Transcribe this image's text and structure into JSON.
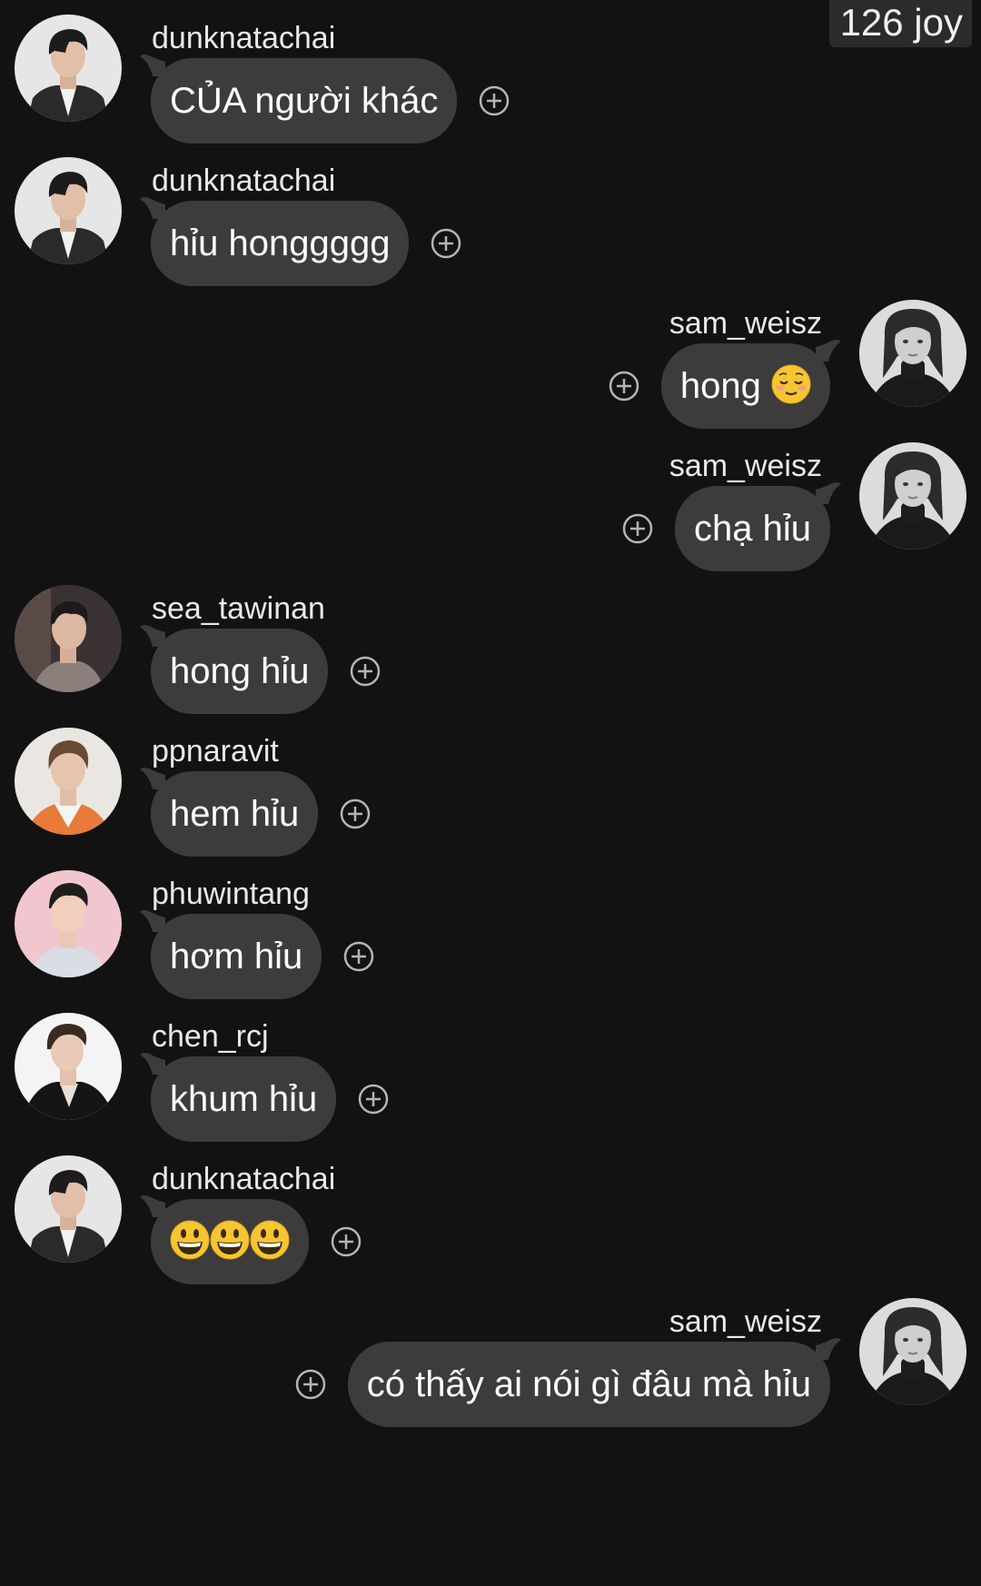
{
  "header": {
    "points_badge": "126 joy"
  },
  "colors": {
    "background": "#121212",
    "bubble": "#3c3c3c",
    "text": "#ffffff",
    "username": "#e9e9e9",
    "icon": "#b5b5b5"
  },
  "messages": [
    {
      "username": "dunknatachai",
      "text": "CỦA người khác",
      "side": "left",
      "avatar": "dunknatachai-avatar",
      "reaction_icon": "add-reaction-icon"
    },
    {
      "username": "dunknatachai",
      "text": "hỉu honggggg",
      "side": "left",
      "avatar": "dunknatachai-avatar",
      "reaction_icon": "add-reaction-icon"
    },
    {
      "username": "sam_weisz",
      "text": "hong",
      "emoji": "relieved-face-emoji",
      "side": "right",
      "avatar": "sam_weisz-avatar",
      "reaction_icon": "add-reaction-icon"
    },
    {
      "username": "sam_weisz",
      "text": "chạ hỉu",
      "side": "right",
      "avatar": "sam_weisz-avatar",
      "reaction_icon": "add-reaction-icon"
    },
    {
      "username": "sea_tawinan",
      "text": "hong hỉu",
      "side": "left",
      "avatar": "sea_tawinan-avatar",
      "reaction_icon": "add-reaction-icon"
    },
    {
      "username": "ppnaravit",
      "text": "hem hỉu",
      "side": "left",
      "avatar": "ppnaravit-avatar",
      "reaction_icon": "add-reaction-icon"
    },
    {
      "username": "phuwintang",
      "text": "hơm hỉu",
      "side": "left",
      "avatar": "phuwintang-avatar",
      "reaction_icon": "add-reaction-icon"
    },
    {
      "username": "chen_rcj",
      "text": "khum hỉu",
      "side": "left",
      "avatar": "chen_rcj-avatar",
      "reaction_icon": "add-reaction-icon"
    },
    {
      "username": "dunknatachai",
      "text": "",
      "emojis": [
        "grinning-face-emoji",
        "grinning-face-emoji",
        "grinning-face-emoji"
      ],
      "side": "left",
      "avatar": "dunknatachai-avatar",
      "reaction_icon": "add-reaction-icon"
    },
    {
      "username": "sam_weisz",
      "text": "có thấy ai nói gì đâu mà hỉu",
      "side": "right",
      "avatar": "sam_weisz-avatar",
      "reaction_icon": "add-reaction-icon"
    }
  ]
}
